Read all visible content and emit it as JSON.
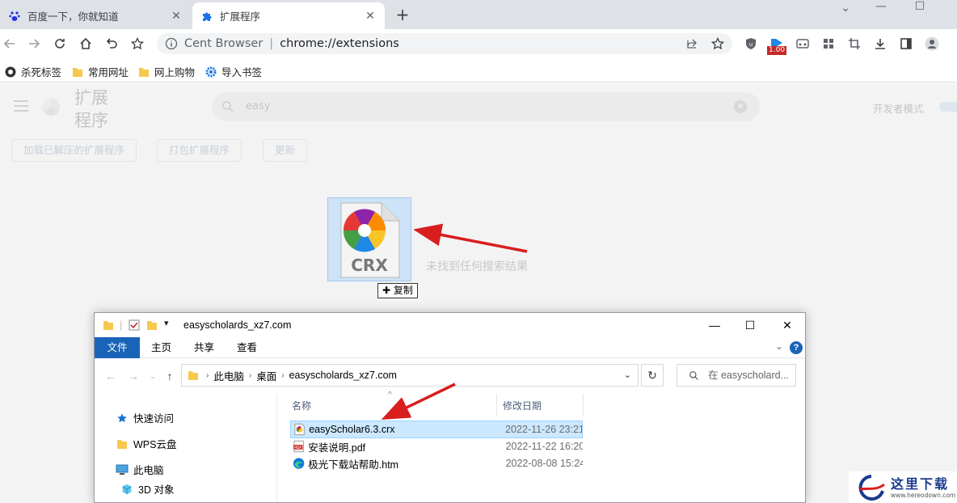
{
  "browser": {
    "tabs": [
      {
        "title": "百度一下，你就知道",
        "active": false
      },
      {
        "title": "扩展程序",
        "active": true
      }
    ],
    "new_tab_symbol": "+",
    "omnibox": {
      "brand": "Cent Browser",
      "url": "chrome://extensions"
    },
    "extension_badge": "1.00",
    "bookmarks": [
      {
        "label": "杀死标签",
        "icon": "kill-tabs-icon"
      },
      {
        "label": "常用网址",
        "icon": "folder-icon"
      },
      {
        "label": "网上购物",
        "icon": "folder-icon"
      },
      {
        "label": "导入书签",
        "icon": "gear-icon"
      }
    ]
  },
  "extensions_page": {
    "title": "扩展程序",
    "search_value": "easy",
    "developer_mode_label": "开发者模式",
    "buttons": [
      "加载已解压的扩展程序",
      "打包扩展程序",
      "更新"
    ],
    "no_result_text": "未找到任何搜索结果",
    "drag_file_label": "CRX",
    "drag_tooltip": "复制"
  },
  "explorer": {
    "window_title": "easyscholards_xz7.com",
    "ribbon_tabs": [
      "文件",
      "主页",
      "共享",
      "查看"
    ],
    "breadcrumbs": [
      "此电脑",
      "桌面",
      "easyscholards_xz7.com"
    ],
    "search_placeholder": "在 easyscholard...",
    "nav_items": [
      {
        "label": "快速访问",
        "icon": "star-icon"
      },
      {
        "label": "WPS云盘",
        "icon": "folder-icon"
      },
      {
        "label": "此电脑",
        "icon": "computer-icon"
      },
      {
        "label": "3D 对象",
        "icon": "cube-icon"
      }
    ],
    "columns": {
      "name": "名称",
      "modified": "修改日期"
    },
    "files": [
      {
        "name": "easyScholar6.3.crx",
        "modified": "2022-11-26 23:21",
        "icon": "crx-file-icon",
        "selected": true
      },
      {
        "name": "安装说明.pdf",
        "modified": "2022-11-22 16:20",
        "icon": "pdf-file-icon",
        "selected": false
      },
      {
        "name": "极光下载站帮助.htm",
        "modified": "2022-08-08 15:24",
        "icon": "edge-file-icon",
        "selected": false
      }
    ]
  },
  "watermark": {
    "text": "这里下载",
    "url": "www.hereodown.com"
  },
  "colors": {
    "accent_blue": "#1a64b8",
    "arrow_red": "#d81e1e",
    "selection": "#cce8ff"
  }
}
